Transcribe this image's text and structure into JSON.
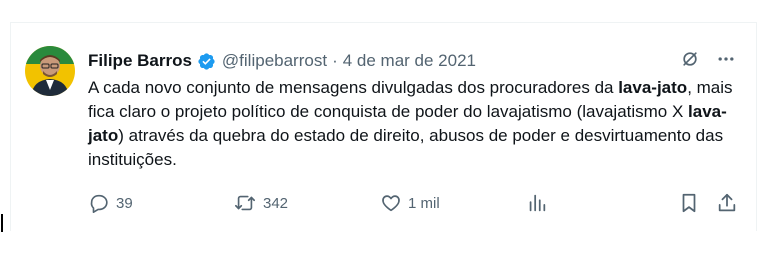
{
  "tweet": {
    "author": {
      "name": "Filipe Barros",
      "handle": "@filipebarrost",
      "verified_icon": "verified-badge-icon"
    },
    "separator": "·",
    "date": "4 de mar de 2021",
    "text": [
      {
        "t": "A cada novo conjunto de mensagens divulgadas dos procuradores da ",
        "bold": false
      },
      {
        "t": "lava-jato",
        "bold": true
      },
      {
        "t": ", mais fica claro o projeto político de conquista de poder do lavajatismo (lavajatismo X ",
        "bold": false
      },
      {
        "t": "lava-jato",
        "bold": true
      },
      {
        "t": ") através da quebra do estado de direito, abusos de poder e desvirtuamento das instituições.",
        "bold": false
      }
    ],
    "stats": {
      "replies": "39",
      "retweets": "342",
      "likes": "1 mil"
    }
  },
  "colors": {
    "text": "#0f1419",
    "muted": "#536471",
    "verified": "#1d9bf0",
    "border": "#eff3f4"
  },
  "icons": [
    "grok-icon",
    "more-icon",
    "reply-icon",
    "retweet-icon",
    "like-icon",
    "views-icon",
    "bookmark-icon",
    "share-icon"
  ]
}
